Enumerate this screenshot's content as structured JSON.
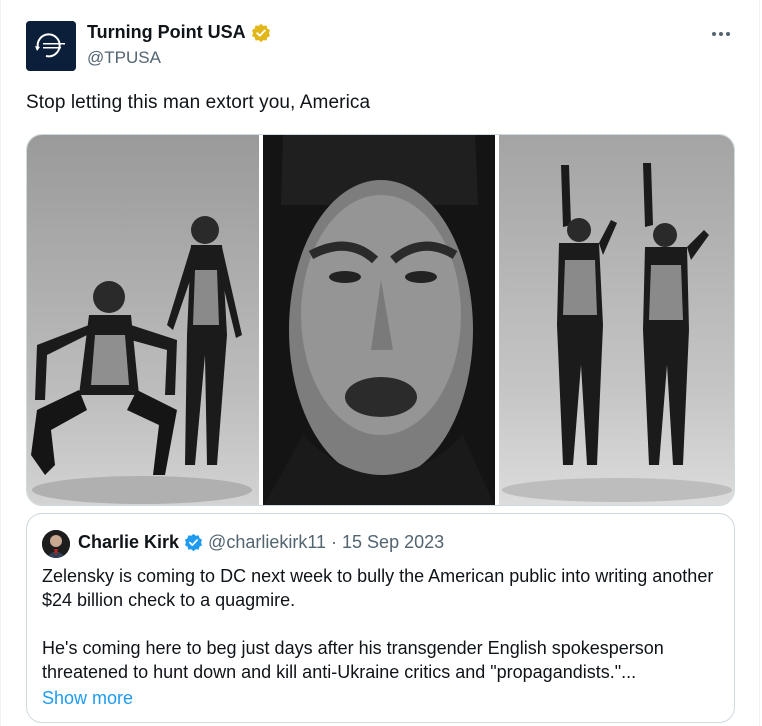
{
  "tweet": {
    "author": {
      "name": "Turning Point USA",
      "handle": "@TPUSA",
      "avatar_text": "TURNING POINT USA",
      "verified_badge_color": "#e2b719"
    },
    "more_icon": "ellipsis-icon",
    "text": "Stop letting this man extort you, America",
    "media": {
      "image_count": 3
    }
  },
  "quoted": {
    "author": {
      "name": "Charlie Kirk",
      "handle": "@charliekirk11",
      "verified_badge_color": "#1d9bf0"
    },
    "separator": "·",
    "date": "15 Sep 2023",
    "paragraph1": "Zelensky is coming to DC next week to bully the American public into writing another $24 billion check to a quagmire.",
    "paragraph2": "He's coming here to beg just days after his transgender English spokesperson threatened to hunt down and kill anti-Ukraine critics and \"propagandists.\"...",
    "show_more": "Show more"
  },
  "colors": {
    "text_primary": "#0f1419",
    "text_secondary": "#536471",
    "link": "#1d9bf0",
    "border": "#cfd9de"
  }
}
